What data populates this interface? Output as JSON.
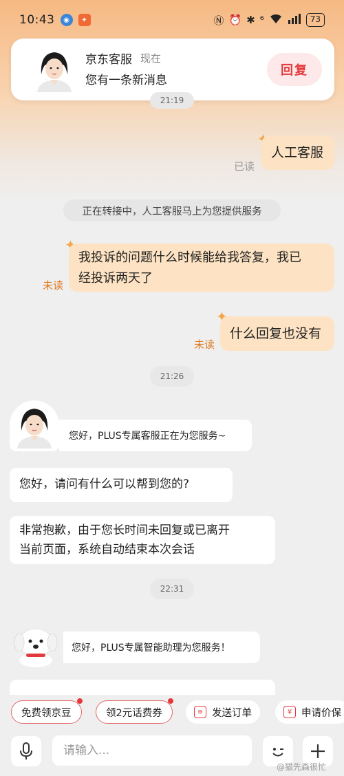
{
  "status_bar": {
    "time": "10:43",
    "battery": "73"
  },
  "notification": {
    "title": "京东客服",
    "time": "现在",
    "body": "您有一条新消息",
    "reply_label": "回复"
  },
  "chat": {
    "time_hidden": "21:19",
    "msg_out_1": {
      "text": "人工客服",
      "status": "已读"
    },
    "system_notice": "正在转接中，人工客服马上为您提供服务",
    "msg_out_2": {
      "line1": "我投诉的问题什么时候能给我答复，我已",
      "line2": "经投诉两天了",
      "status": "未读"
    },
    "msg_out_3": {
      "text": "什么回复也没有",
      "status": "未读"
    },
    "time_1": "21:26",
    "agent_greeting": "您好，PLUS专属客服正在为您服务~",
    "msg_in_1": "您好，请问有什么可以帮到您的?",
    "msg_in_2": {
      "line1": "非常抱歉，由于您长时间未回复或已离开",
      "line2": "当前页面，系统自动结束本次会话"
    },
    "time_2": "22:31",
    "bot_greeting": "您好，PLUS专属智能助理为您服务！"
  },
  "quick_actions": [
    {
      "label": "免费领京豆"
    },
    {
      "label": "领2元话费券"
    },
    {
      "label": "发送订单"
    },
    {
      "label": "申请价保"
    }
  ],
  "input": {
    "placeholder": "请输入..."
  },
  "watermark": "@猫先森很忙",
  "colors": {
    "accent": "#e4393c",
    "bubble_out": "#fde3c3",
    "unread": "#e07a1f",
    "read": "#999999"
  }
}
